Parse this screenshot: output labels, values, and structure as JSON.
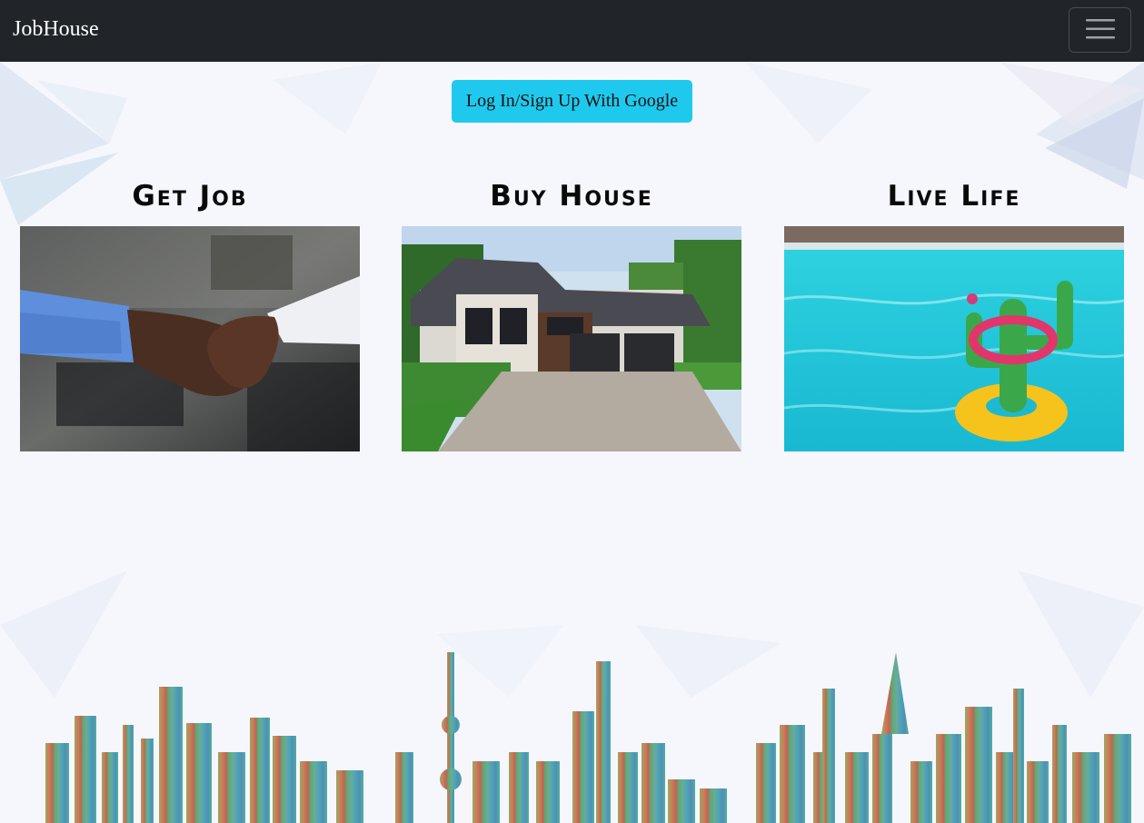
{
  "navbar": {
    "brand": "JobHouse",
    "toggler_icon": "hamburger-menu-icon"
  },
  "login": {
    "label": "Log In/Sign Up With Google"
  },
  "cards": [
    {
      "title": "Get Job",
      "image": "handshake-photo"
    },
    {
      "title": "Buy House",
      "image": "modern-house-photo"
    },
    {
      "title": "Live Life",
      "image": "pool-cactus-float-photo"
    }
  ],
  "colors": {
    "navbar_bg": "#212529",
    "button_bg": "#1fc9ee"
  }
}
